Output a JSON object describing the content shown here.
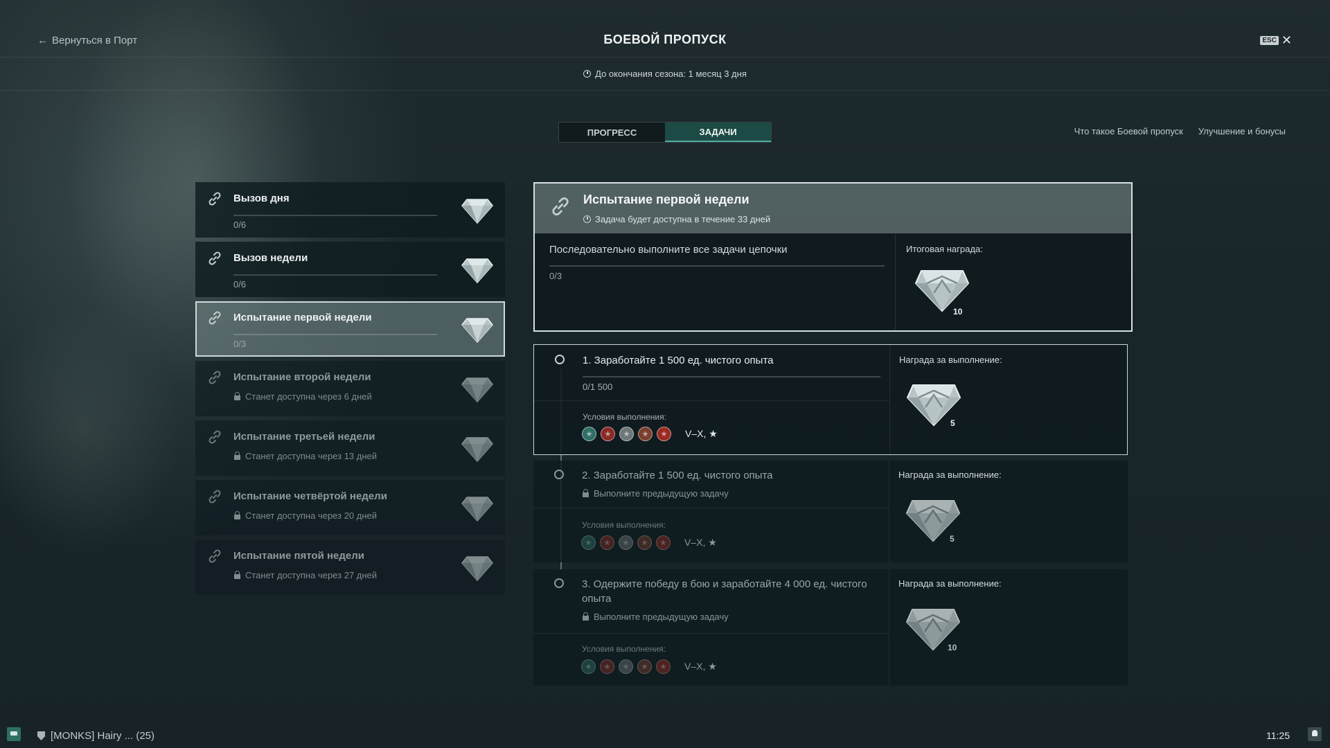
{
  "header": {
    "back_label": "Вернуться в Порт",
    "title": "БОЕВОЙ ПРОПУСК",
    "esc_label": "ESC",
    "season_text": "До окончания сезона: 1 месяц 3 дня"
  },
  "tabs": [
    {
      "label": "ПРОГРЕСС",
      "active": false
    },
    {
      "label": "ЗАДАЧИ",
      "active": true
    }
  ],
  "help_links": [
    "Что такое Боевой пропуск",
    "Улучшение и бонусы"
  ],
  "chains": [
    {
      "title": "Вызов дня",
      "progress": "0/6",
      "state": "available"
    },
    {
      "title": "Вызов недели",
      "progress": "0/6",
      "state": "available"
    },
    {
      "title": "Испытание первой недели",
      "progress": "0/3",
      "state": "selected"
    },
    {
      "title": "Испытание второй недели",
      "lock_text": "Станет доступна через 6 дней",
      "state": "locked"
    },
    {
      "title": "Испытание третьей недели",
      "lock_text": "Станет доступна через 13 дней",
      "state": "locked"
    },
    {
      "title": "Испытание четвёртой недели",
      "lock_text": "Станет доступна через 20 дней",
      "state": "locked"
    },
    {
      "title": "Испытание пятой недели",
      "lock_text": "Станет доступна через 27 дней",
      "state": "locked"
    }
  ],
  "detail": {
    "title": "Испытание первой недели",
    "availability": "Задача будет доступна в течение 33 дней",
    "description": "Последовательно выполните все задачи цепочки",
    "progress": "0/3",
    "final_reward_label": "Итоговая награда:",
    "final_reward_amount": "10"
  },
  "tasks": [
    {
      "text": "1. Заработайте 1 500 ед. чистого опыта",
      "progress": "0/1 500",
      "conditions_label": "Условия выполнения:",
      "tiers": "V–X, ★",
      "reward_label": "Награда за выполнение:",
      "reward_amount": "5",
      "state": "active"
    },
    {
      "text": "2. Заработайте 1 500 ед. чистого опыта",
      "lock_text": "Выполните предыдущую задачу",
      "conditions_label": "Условия выполнения:",
      "tiers": "V–X, ★",
      "reward_label": "Награда за выполнение:",
      "reward_amount": "5",
      "state": "locked"
    },
    {
      "text": "3. Одержите победу в бою и заработайте 4 000 ед. чистого опыта",
      "lock_text": "Выполните предыдущую задачу",
      "conditions_label": "Условия выполнения:",
      "tiers": "V–X, ★",
      "reward_label": "Награда за выполнение:",
      "reward_amount": "10",
      "state": "locked"
    }
  ],
  "nation_colors": [
    "#2f6f66",
    "#8a2a24",
    "#6d7678",
    "#7a3f2c",
    "#9a2a22"
  ],
  "footer": {
    "player": "[MONKS] Hairy ... (25)",
    "time": "11:25"
  }
}
